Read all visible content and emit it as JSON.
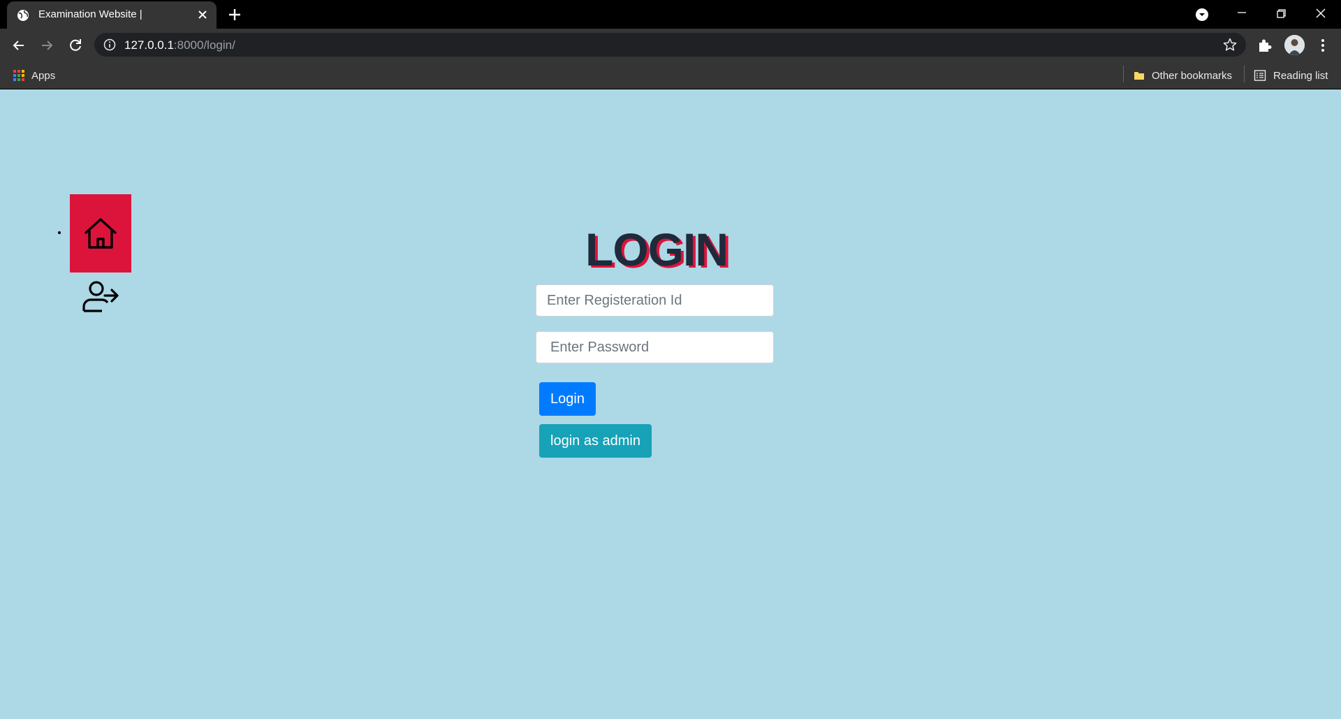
{
  "browser": {
    "tab_title": "Examination Website |",
    "url_host": "127.0.0.1",
    "url_path": ":8000/login/",
    "bookmarks": {
      "apps": "Apps",
      "other_bookmarks": "Other bookmarks",
      "reading_list": "Reading list"
    }
  },
  "sidebar": {
    "items": [
      {
        "icon": "home-icon",
        "active": true
      },
      {
        "icon": "logout-icon",
        "active": false
      }
    ],
    "active_color": "#dc143c"
  },
  "login": {
    "title": "LOGIN",
    "registration_placeholder": "Enter Registeration Id",
    "password_placeholder": "Enter Password",
    "login_button": "Login",
    "admin_button": "login as admin"
  },
  "colors": {
    "background": "#add8e6",
    "primary": "#007bff",
    "info": "#17a2b8",
    "title_shadow": "#dc143c"
  }
}
